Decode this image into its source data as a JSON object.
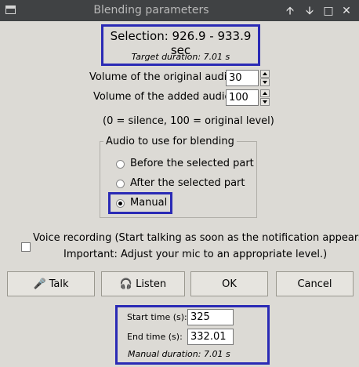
{
  "window": {
    "title": "Blending parameters",
    "controls": [
      "up-arrow",
      "down-arrow",
      "restore",
      "close"
    ]
  },
  "selection": {
    "text": "Selection: 926.9 - 933.9 sec",
    "target": "Target duration: 7.01 s"
  },
  "volumes": {
    "original_label": "Volume of the original audio:",
    "original_value": "30",
    "added_label": "Volume of the added audio:",
    "added_value": "100",
    "hint": "(0 = silence, 100 = original level)"
  },
  "blend": {
    "legend": "Audio to use for blending",
    "options": [
      "Before the selected part",
      "After the selected part",
      "Manual"
    ],
    "selected": "Manual"
  },
  "voice": {
    "line1": "Voice recording (Start talking as soon as the notification appears.",
    "line2": "Important: Adjust your mic to an appropriate level.)",
    "checked": false
  },
  "buttons": {
    "talk": "Talk",
    "listen": "Listen",
    "ok": "OK",
    "cancel": "Cancel"
  },
  "manual": {
    "start_label": "Start time (s):",
    "start_value": "325",
    "end_label": "End time (s):",
    "end_value": "332.01",
    "duration": "Manual duration: 7.01 s"
  },
  "colors": {
    "highlight": "#2a2ab5",
    "titlebar": "#404244",
    "background": "#dcdad5"
  }
}
